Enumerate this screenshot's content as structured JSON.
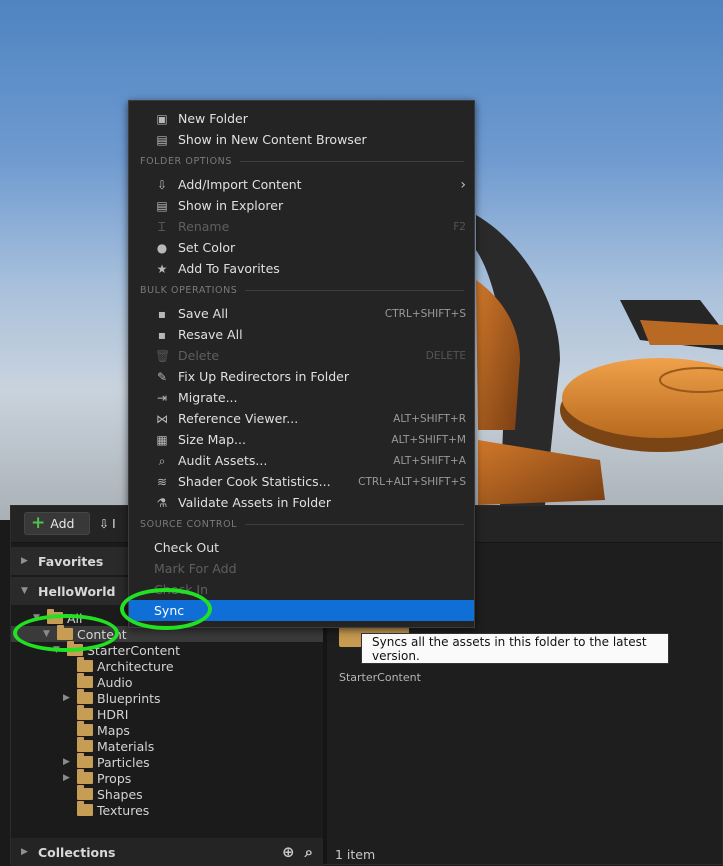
{
  "toolbar": {
    "add_label": "Add",
    "import_label": "I"
  },
  "panels": {
    "favorites": "Favorites",
    "project": "HelloWorld",
    "collections": "Collections"
  },
  "tree": [
    {
      "label": "All",
      "caret": "▼",
      "indent": 0
    },
    {
      "label": "Content",
      "caret": "▼",
      "indent": 1,
      "selected": true
    },
    {
      "label": "StarterContent",
      "caret": "▼",
      "indent": 2
    },
    {
      "label": "Architecture",
      "caret": "",
      "indent": 3
    },
    {
      "label": "Audio",
      "caret": "",
      "indent": 3
    },
    {
      "label": "Blueprints",
      "caret": "▶",
      "indent": 3
    },
    {
      "label": "HDRI",
      "caret": "",
      "indent": 3
    },
    {
      "label": "Maps",
      "caret": "",
      "indent": 3
    },
    {
      "label": "Materials",
      "caret": "",
      "indent": 3
    },
    {
      "label": "Particles",
      "caret": "▶",
      "indent": 3
    },
    {
      "label": "Props",
      "caret": "▶",
      "indent": 3
    },
    {
      "label": "Shapes",
      "caret": "",
      "indent": 3
    },
    {
      "label": "Textures",
      "caret": "",
      "indent": 3
    }
  ],
  "asset": {
    "label": "StarterContent"
  },
  "status": {
    "item_count": "1 item"
  },
  "menu": {
    "top": [
      {
        "label": "New Folder",
        "icon": "new-folder-icon"
      },
      {
        "label": "Show in New Content Browser",
        "icon": "content-browser-icon"
      }
    ],
    "sections": {
      "folder_options": "FOLDER OPTIONS",
      "bulk_operations": "BULK OPERATIONS",
      "source_control": "SOURCE CONTROL"
    },
    "folder_options": [
      {
        "label": "Add/Import Content",
        "icon": "import-icon",
        "submenu": true
      },
      {
        "label": "Show in Explorer",
        "icon": "explorer-icon"
      },
      {
        "label": "Rename",
        "icon": "rename-icon",
        "shortcut": "F2",
        "disabled": true
      },
      {
        "label": "Set Color",
        "icon": "color-icon"
      },
      {
        "label": "Add To Favorites",
        "icon": "star-icon"
      }
    ],
    "bulk_operations": [
      {
        "label": "Save All",
        "icon": "save-icon",
        "shortcut": "CTRL+SHIFT+S"
      },
      {
        "label": "Resave All",
        "icon": "save-icon"
      },
      {
        "label": "Delete",
        "icon": "trash-icon",
        "shortcut": "DELETE",
        "disabled": true
      },
      {
        "label": "Fix Up Redirectors in Folder",
        "icon": "wrench-icon"
      },
      {
        "label": "Migrate...",
        "icon": "migrate-icon"
      },
      {
        "label": "Reference Viewer...",
        "icon": "reference-icon",
        "shortcut": "ALT+SHIFT+R"
      },
      {
        "label": "Size Map...",
        "icon": "size-map-icon",
        "shortcut": "ALT+SHIFT+M"
      },
      {
        "label": "Audit Assets...",
        "icon": "audit-icon",
        "shortcut": "ALT+SHIFT+A"
      },
      {
        "label": "Shader Cook Statistics...",
        "icon": "shader-icon",
        "shortcut": "CTRL+ALT+SHIFT+S"
      },
      {
        "label": "Validate Assets in Folder",
        "icon": "flask-icon"
      }
    ],
    "source_control": [
      {
        "label": "Check Out"
      },
      {
        "label": "Mark For Add",
        "disabled": true
      },
      {
        "label": "Check In",
        "disabled": true
      },
      {
        "label": "Sync",
        "highlight": true
      }
    ]
  },
  "tooltip": {
    "text": "Syncs all the assets in this folder to the latest version."
  },
  "colors": {
    "highlight": "#0f6fd6",
    "annotation_ring": "#22e022",
    "folder": "#c79c55"
  }
}
